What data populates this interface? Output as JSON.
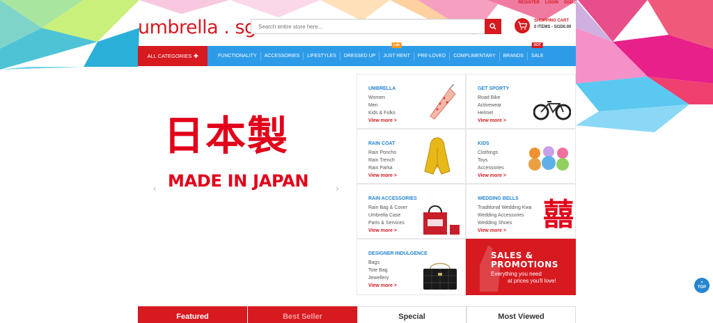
{
  "top_links": {
    "register": "REGISTER",
    "login": "LOGIN",
    "currency": "SGD"
  },
  "logo": {
    "text": "umbrella . sg"
  },
  "search": {
    "placeholder": "Search entire store here..."
  },
  "cart": {
    "title": "SHOPPING CART",
    "summary": "0 ITEMS - SGD0.00"
  },
  "nav": {
    "all_categories": "ALL CATEGORIES",
    "items": [
      {
        "label": "FUNCTIONALITY"
      },
      {
        "label": "ACCESSORIES"
      },
      {
        "label": "LIFESTYLES"
      },
      {
        "label": "DRESSED UP"
      },
      {
        "label": "JUST RENT",
        "badge": "Lah"
      },
      {
        "label": "PRE-LOVED"
      },
      {
        "label": "COMPLIMENTARY"
      },
      {
        "label": "BRANDS"
      },
      {
        "label": "SALE",
        "badge": "HOT"
      }
    ],
    "badge_colors": {
      "lah": "#f7941d",
      "hot": "#d71920"
    }
  },
  "banner": {
    "kanji": "日本製",
    "caption": "MADE IN JAPAN",
    "prev": "‹",
    "next": "›"
  },
  "categories": [
    {
      "title": "UMBRELLA",
      "items": [
        "Women",
        "Men",
        "Kids & Folks"
      ],
      "more": "View more >",
      "icon": "umbrella-icon"
    },
    {
      "title": "GET SPORTY",
      "items": [
        "Road Bike",
        "Activewear",
        "Helmet"
      ],
      "more": "View more >",
      "icon": "bicycle-icon"
    },
    {
      "title": "RAIN COAT",
      "items": [
        "Rain Poncho",
        "Rain Trench",
        "Rain Parka"
      ],
      "more": "View more >",
      "icon": "raincoat-icon"
    },
    {
      "title": "KIDS",
      "items": [
        "Clothings",
        "Toys",
        "Accessories"
      ],
      "more": "View more >",
      "icon": "toys-icon"
    },
    {
      "title": "RAIN ACCESSORIES",
      "items": [
        "Rain Bag & Cover",
        "Umbrella Case",
        "Parts & Services"
      ],
      "more": "View more >",
      "icon": "tote-bag-icon"
    },
    {
      "title": "WEDDING BELLS",
      "items": [
        "Traditional Wedding Kwa",
        "Wedding Accessories",
        "Wedding Shoes"
      ],
      "more": "View more >",
      "icon": "double-happiness-icon"
    },
    {
      "title": "DESIGNER INDULGENCE",
      "items": [
        "Bags",
        "Tote Bag",
        "Jewellery"
      ],
      "more": "View more >",
      "icon": "handbag-icon"
    }
  ],
  "promo": {
    "line1": "SALES &",
    "line2": "PROMOTIONS",
    "line3": "Everything you need",
    "line4": "at prices you'll love!"
  },
  "tabs": [
    {
      "label": "Featured"
    },
    {
      "label": "Best Seller"
    },
    {
      "label": "Special"
    },
    {
      "label": "Most Viewed"
    }
  ],
  "top_button": {
    "label": "TOP"
  },
  "colors": {
    "brand_red": "#d71920",
    "nav_blue": "#2e9be8",
    "link_blue": "#2585d0"
  }
}
